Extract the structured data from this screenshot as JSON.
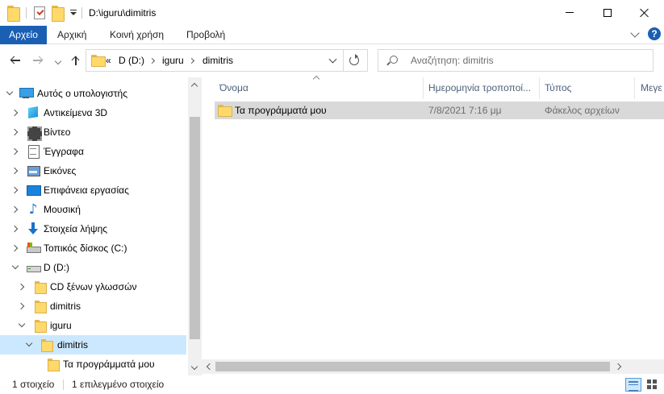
{
  "window": {
    "title": "D:\\iguru\\dimitris"
  },
  "ribbon": {
    "tabs": [
      "Αρχείο",
      "Αρχική",
      "Κοινή χρήση",
      "Προβολή"
    ],
    "help_label": "?"
  },
  "address_bar": {
    "overflow": "«",
    "breadcrumbs": [
      "D (D:)",
      "iguru",
      "dimitris"
    ]
  },
  "search": {
    "placeholder": "Αναζήτηση: dimitris"
  },
  "nav_tree": [
    {
      "label": "Αυτός ο υπολογιστής",
      "icon": "computer-icon",
      "expanded": true
    },
    {
      "label": "Αντικείμενα 3D",
      "icon": "objects-3d-icon"
    },
    {
      "label": "Βίντεο",
      "icon": "video-icon"
    },
    {
      "label": "Έγγραφα",
      "icon": "documents-icon"
    },
    {
      "label": "Εικόνες",
      "icon": "pictures-icon"
    },
    {
      "label": "Επιφάνεια εργασίας",
      "icon": "desktop-icon"
    },
    {
      "label": "Μουσική",
      "icon": "music-icon"
    },
    {
      "label": "Στοιχεία λήψης",
      "icon": "downloads-icon"
    },
    {
      "label": "Τοπικός δίσκος (C:)",
      "icon": "local-disk-icon"
    },
    {
      "label": "D (D:)",
      "icon": "drive-icon",
      "expanded": true
    },
    {
      "label": "CD ξένων γλωσσών",
      "icon": "folder-icon"
    },
    {
      "label": "dimitris",
      "icon": "folder-icon"
    },
    {
      "label": "iguru",
      "icon": "folder-icon",
      "expanded": true
    },
    {
      "label": "dimitris",
      "icon": "folder-icon",
      "expanded": true,
      "selected": true
    },
    {
      "label": "Τα προγράμματά μου",
      "icon": "folder-icon"
    }
  ],
  "columns": [
    "Όνομα",
    "Ημερομηνία τροποποί...",
    "Τύπος",
    "Μεγε"
  ],
  "files": [
    {
      "name": "Τα προγράμματά μου",
      "modified": "7/8/2021 7:16 μμ",
      "type": "Φάκελος αρχείων",
      "icon": "folder-icon"
    }
  ],
  "status": {
    "item_count": "1 στοιχείο",
    "selected_count": "1 επιλεγμένο στοιχείο"
  },
  "colors": {
    "file_tab": "#1a5fb4",
    "selection": "#cce8ff",
    "row_highlight": "#d9d9d9",
    "folder": "#ffd96a"
  }
}
